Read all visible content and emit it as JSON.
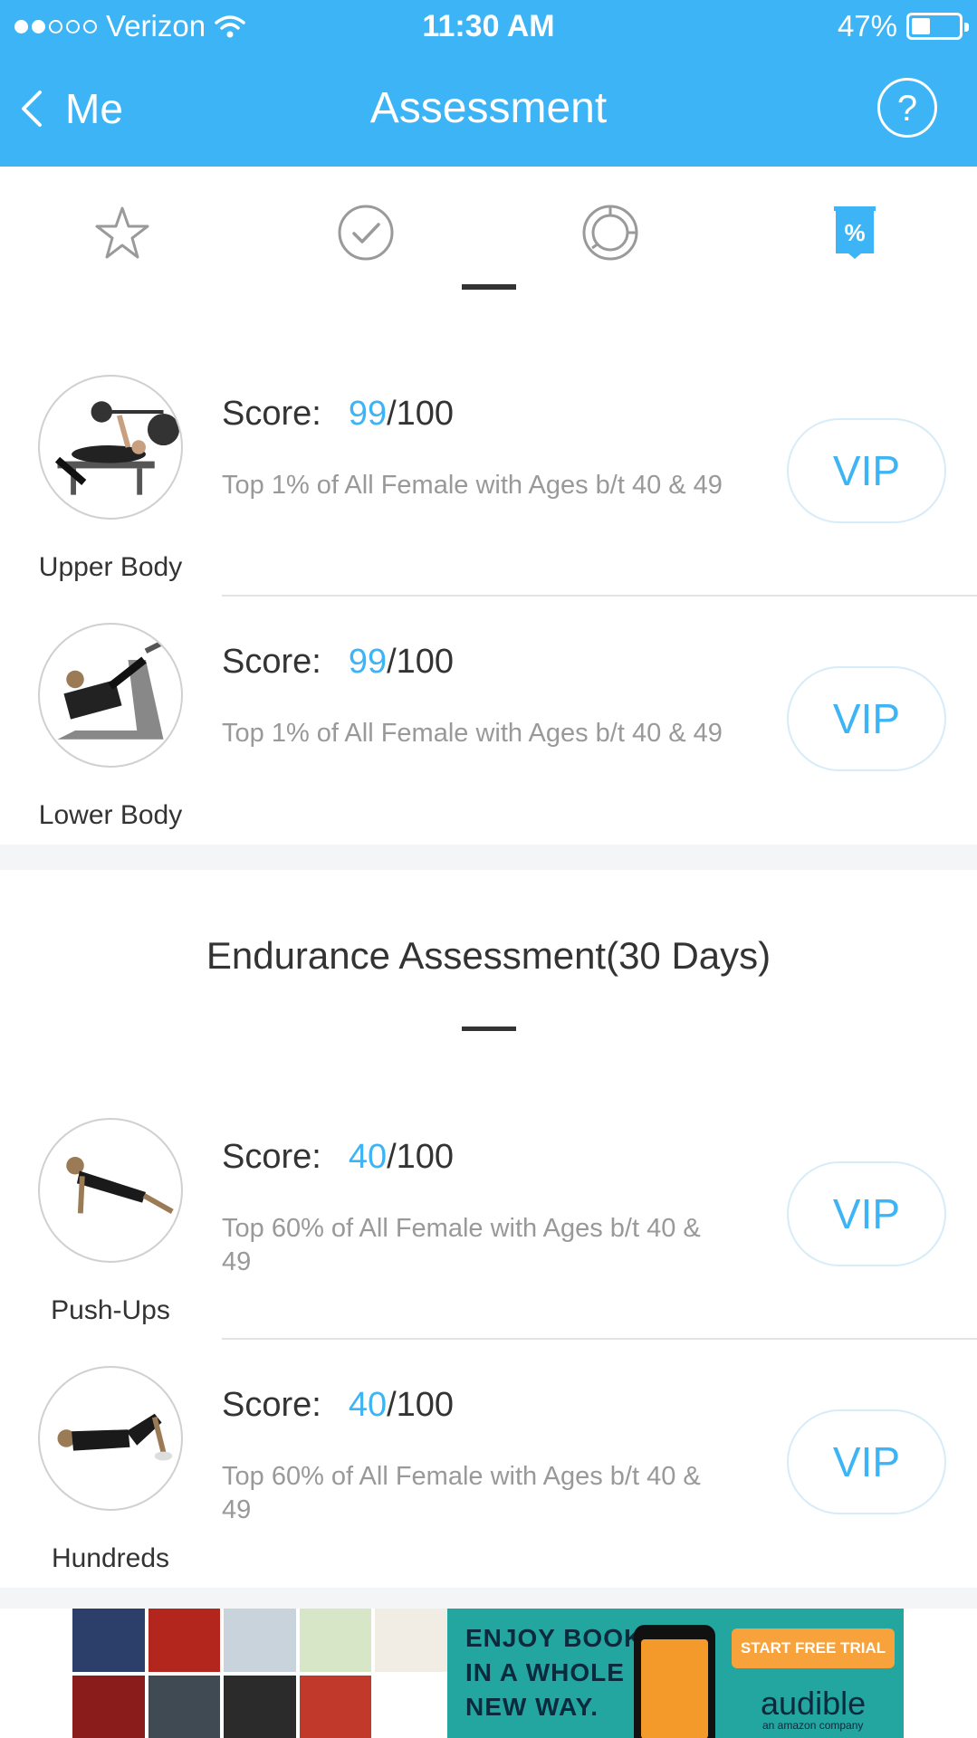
{
  "status_bar": {
    "carrier": "Verizon",
    "time": "11:30 AM",
    "battery": "47%",
    "battery_level": 0.47
  },
  "nav": {
    "back_label": "Me",
    "title": "Assessment",
    "help_label": "?"
  },
  "tabs": [
    {
      "icon": "star-icon",
      "active": false
    },
    {
      "icon": "check-circle-icon",
      "active": false
    },
    {
      "icon": "chart-ring-icon",
      "active": false
    },
    {
      "icon": "percent-badge-icon",
      "active": true,
      "label": "%"
    }
  ],
  "strength_rows": [
    {
      "label": "Upper Body",
      "score_prefix": "Score:",
      "score": "99",
      "score_max": "/100",
      "description": "Top 1% of All Female with Ages b/t 40 & 49",
      "button": "VIP"
    },
    {
      "label": "Lower Body",
      "score_prefix": "Score:",
      "score": "99",
      "score_max": "/100",
      "description": "Top 1% of All Female with Ages b/t 40 & 49",
      "button": "VIP"
    }
  ],
  "endurance": {
    "title": "Endurance Assessment(30 Days)",
    "rows": [
      {
        "label": "Push-Ups",
        "score_prefix": "Score:",
        "score": "40",
        "score_max": "/100",
        "description": "Top 60% of All Female with Ages b/t 40 & 49",
        "button": "VIP"
      },
      {
        "label": "Hundreds",
        "score_prefix": "Score:",
        "score": "40",
        "score_max": "/100",
        "description": "Top 60% of All Female with Ages b/t 40 & 49",
        "button": "VIP"
      }
    ]
  },
  "ad": {
    "headline": "ENJOY BOOKS IN A WHOLE NEW WAY.",
    "headline_lines": [
      "ENJOY BOOKS",
      "IN A WHOLE",
      "NEW WAY."
    ],
    "cta": "START FREE TRIAL",
    "brand": "audible",
    "brand_sub": "an amazon company"
  },
  "colors": {
    "accent": "#3db4f5",
    "text": "#333333",
    "muted": "#999999"
  }
}
